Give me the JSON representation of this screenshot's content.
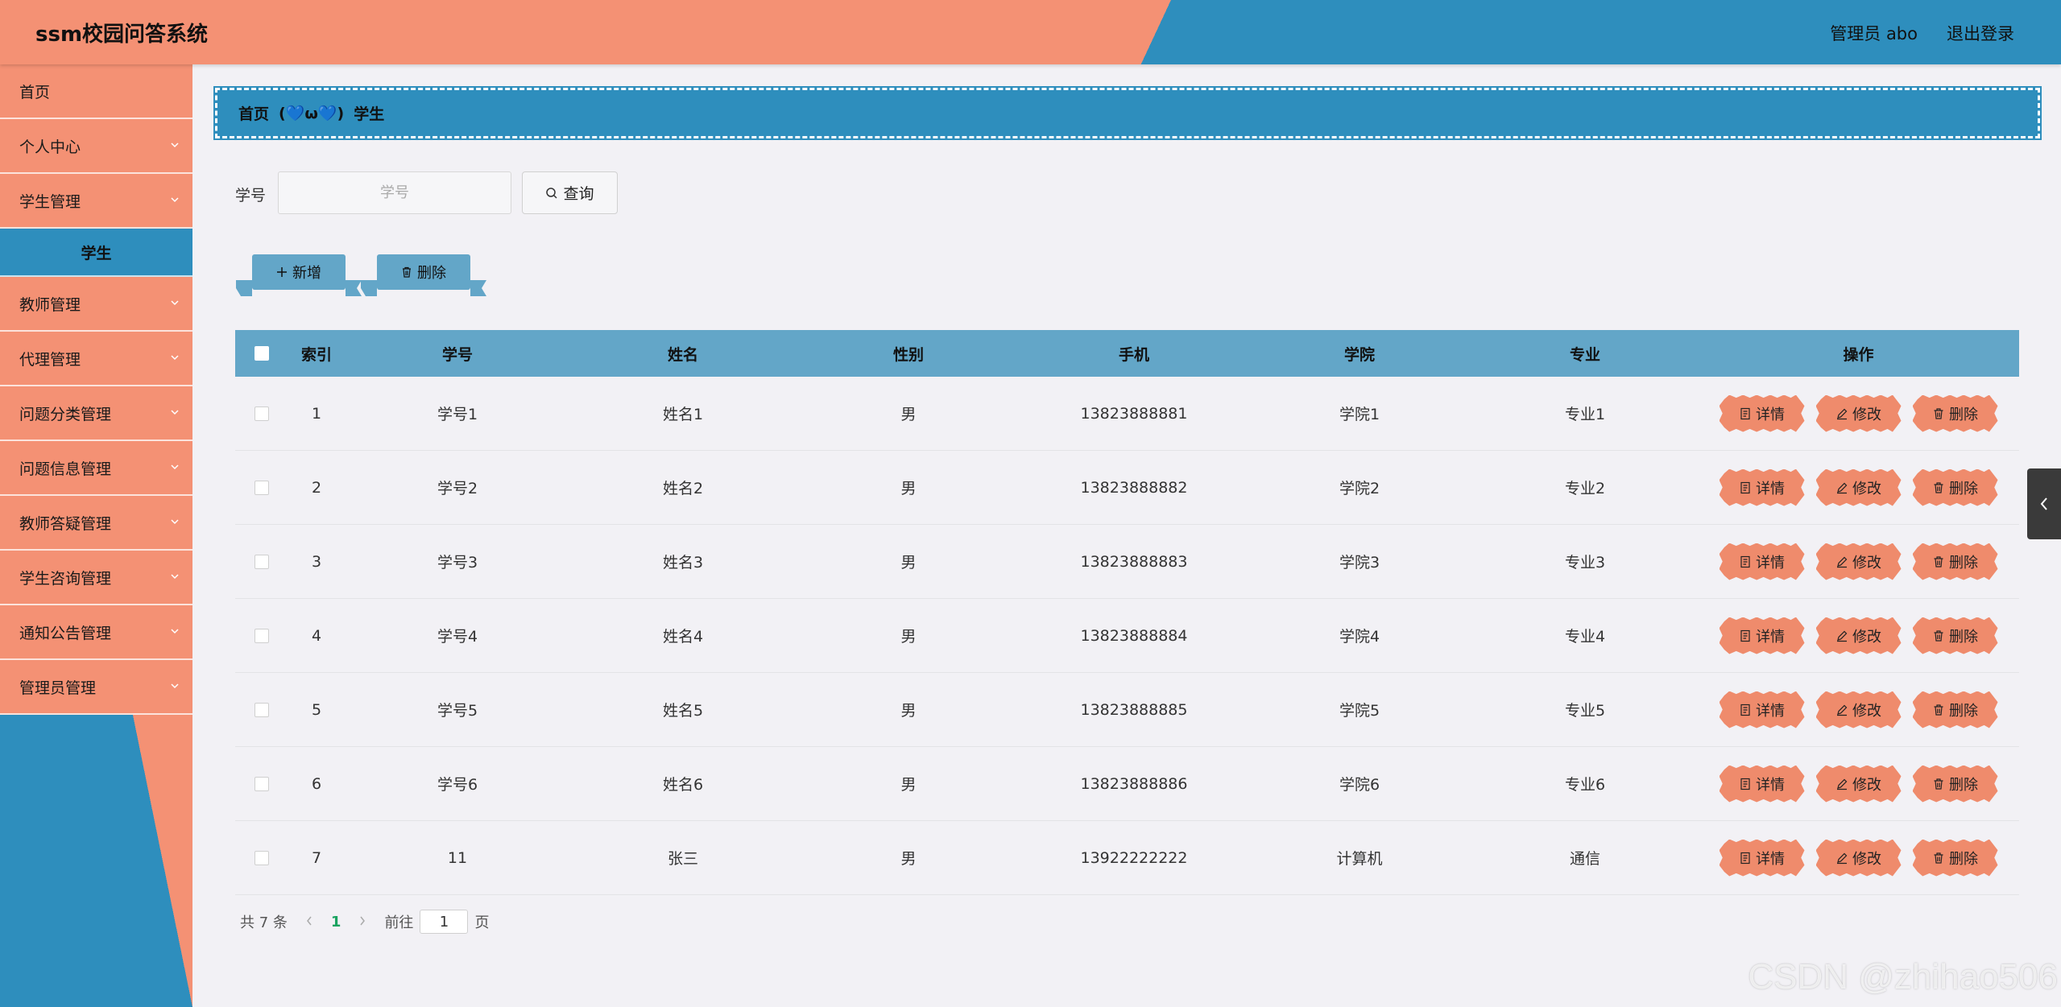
{
  "header": {
    "title": "ssm校园问答系统",
    "user": "管理员 abo",
    "logout": "退出登录"
  },
  "sidebar": {
    "items": [
      {
        "label": "首页"
      },
      {
        "label": "个人中心"
      },
      {
        "label": "学生管理"
      },
      {
        "label": "学生"
      },
      {
        "label": "教师管理"
      },
      {
        "label": "代理管理"
      },
      {
        "label": "问题分类管理"
      },
      {
        "label": "问题信息管理"
      },
      {
        "label": "教师答疑管理"
      },
      {
        "label": "学生咨询管理"
      },
      {
        "label": "通知公告管理"
      },
      {
        "label": "管理员管理"
      }
    ]
  },
  "breadcrumb": {
    "home": "首页",
    "separator": "(💙ω💙)",
    "current": "学生"
  },
  "search": {
    "label": "学号",
    "placeholder": "学号",
    "button": "查询"
  },
  "actions": {
    "add": "新增",
    "delete": "删除"
  },
  "table": {
    "headers": [
      "索引",
      "学号",
      "姓名",
      "性别",
      "手机",
      "学院",
      "专业",
      "操作"
    ],
    "rows": [
      [
        "1",
        "学号1",
        "姓名1",
        "男",
        "13823888881",
        "学院1",
        "专业1"
      ],
      [
        "2",
        "学号2",
        "姓名2",
        "男",
        "13823888882",
        "学院2",
        "专业2"
      ],
      [
        "3",
        "学号3",
        "姓名3",
        "男",
        "13823888883",
        "学院3",
        "专业3"
      ],
      [
        "4",
        "学号4",
        "姓名4",
        "男",
        "13823888884",
        "学院4",
        "专业4"
      ],
      [
        "5",
        "学号5",
        "姓名5",
        "男",
        "13823888885",
        "学院5",
        "专业5"
      ],
      [
        "6",
        "学号6",
        "姓名6",
        "男",
        "13823888886",
        "学院6",
        "专业6"
      ],
      [
        "7",
        "11",
        "张三",
        "男",
        "13922222222",
        "计算机",
        "通信"
      ]
    ],
    "ops": {
      "detail": "详情",
      "edit": "修改",
      "delete": "删除"
    }
  },
  "pager": {
    "total": "共 7 条",
    "current": "1",
    "goto_prefix": "前往",
    "goto_value": "1",
    "goto_suffix": "页"
  },
  "watermark": "CSDN @zhihao506",
  "colors": {
    "salmon": "#f49174",
    "blue": "#2e8ebd",
    "table_header": "#63a6c8"
  }
}
